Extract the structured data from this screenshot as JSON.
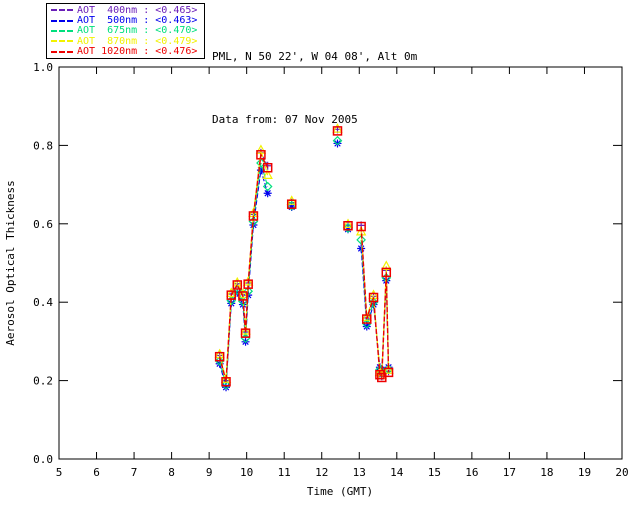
{
  "window": {
    "background": "#ffffff"
  },
  "header": {
    "line1": "PML, N 50 22', W 04 08', Alt 0m",
    "line2": "Data from: 07 Nov 2005"
  },
  "legend": {
    "entries": [
      {
        "id": "aot-400nm",
        "label": "AOT  400nm :",
        "value": "<0.465>",
        "color": "#6a1fb8"
      },
      {
        "id": "aot-500nm",
        "label": "AOT  500nm :",
        "value": "<0.463>",
        "color": "#0000ee"
      },
      {
        "id": "aot-675nm",
        "label": "AOT  675nm :",
        "value": "<0.470>",
        "color": "#00df7d"
      },
      {
        "id": "aot-870nm",
        "label": "AOT  870nm :",
        "value": "<0.479>",
        "color": "#f2f200"
      },
      {
        "id": "aot-1020nm",
        "label": "AOT 1020nm :",
        "value": "<0.476>",
        "color": "#ee0000"
      }
    ]
  },
  "chart_data": {
    "type": "line",
    "title": "",
    "xlabel": "Time (GMT)",
    "ylabel": "Aerosol Optical Thickness",
    "xlim": [
      5,
      20
    ],
    "ylim": [
      0.0,
      1.0
    ],
    "xticks": [
      5,
      6,
      7,
      8,
      9,
      10,
      11,
      12,
      13,
      14,
      15,
      16,
      17,
      18,
      19,
      20
    ],
    "yticks": [
      0.0,
      0.2,
      0.4,
      0.6,
      0.8,
      1.0
    ],
    "grid": false,
    "legend_position": "top-left",
    "gap_threshold": 0.25,
    "x": [
      9.28,
      9.45,
      9.59,
      9.75,
      9.9,
      9.97,
      10.04,
      10.18,
      10.38,
      10.56,
      11.2,
      12.42,
      12.7,
      13.05,
      13.2,
      13.38,
      13.55,
      13.6,
      13.72,
      13.78
    ],
    "series": [
      {
        "name": "AOT 400nm",
        "mean": 0.465,
        "color": "#6a1fb8",
        "marker": "plus",
        "values": [
          0.264,
          0.2,
          0.421,
          0.447,
          0.419,
          0.324,
          0.449,
          0.624,
          0.781,
          0.748,
          0.654,
          0.841,
          0.597,
          0.596,
          0.36,
          0.415,
          0.218,
          0.211,
          0.481,
          0.224
        ]
      },
      {
        "name": "AOT 500nm",
        "mean": 0.463,
        "color": "#0000ee",
        "marker": "asterisk",
        "values": [
          0.243,
          0.183,
          0.397,
          0.424,
          0.394,
          0.299,
          0.418,
          0.597,
          0.737,
          0.678,
          0.643,
          0.805,
          0.586,
          0.537,
          0.338,
          0.394,
          0.234,
          0.226,
          0.455,
          0.234
        ]
      },
      {
        "name": "AOT 675nm",
        "mean": 0.47,
        "color": "#00df7d",
        "marker": "diamond",
        "values": [
          0.25,
          0.189,
          0.404,
          0.431,
          0.402,
          0.308,
          0.428,
          0.606,
          0.755,
          0.695,
          0.646,
          0.812,
          0.589,
          0.559,
          0.345,
          0.4,
          0.228,
          0.22,
          0.462,
          0.229
        ]
      },
      {
        "name": "AOT 870nm",
        "mean": 0.479,
        "color": "#f2f200",
        "marker": "triangle",
        "values": [
          0.267,
          0.204,
          0.423,
          0.45,
          0.421,
          0.327,
          0.452,
          0.627,
          0.788,
          0.724,
          0.658,
          0.842,
          0.599,
          0.58,
          0.362,
          0.418,
          0.221,
          0.214,
          0.492,
          0.227
        ]
      },
      {
        "name": "AOT 1020nm",
        "mean": 0.476,
        "color": "#ee0000",
        "marker": "square",
        "values": [
          0.261,
          0.197,
          0.418,
          0.444,
          0.416,
          0.321,
          0.446,
          0.62,
          0.776,
          0.743,
          0.65,
          0.837,
          0.595,
          0.593,
          0.357,
          0.412,
          0.215,
          0.208,
          0.476,
          0.221
        ]
      }
    ]
  }
}
